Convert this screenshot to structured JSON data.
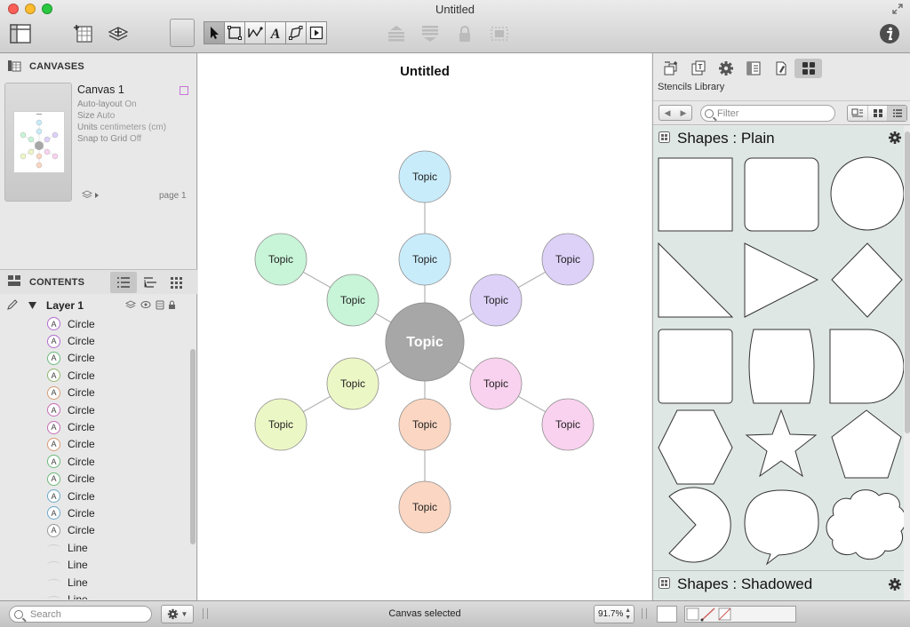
{
  "window": {
    "title": "Untitled"
  },
  "colors": {
    "accent_purple": "#b06ad0",
    "node_center": "#a7a7a7",
    "node_blue": "#c9ecfb",
    "node_green": "#c8f4d8",
    "node_purple": "#ddd1f8",
    "node_pink": "#f9d2ef",
    "node_yellow": "#ecf7c6",
    "node_peach": "#fbd6c2"
  },
  "toolbar": {
    "icons": [
      "sidebar-toggle-icon",
      "canvas-add-icon",
      "layer-add-icon",
      "style-well-icon",
      "selection-tool-icon",
      "shape-tool-icon",
      "line-tool-icon",
      "text-tool-icon",
      "pen-tool-icon",
      "browse-tool-icon",
      "bring-front-icon",
      "send-back-icon",
      "lock-icon",
      "group-icon",
      "inspector-info-icon"
    ]
  },
  "canvases": {
    "header": "CANVASES",
    "canvas_name": "Canvas 1",
    "props": [
      {
        "key": "Auto-layout",
        "value": "On"
      },
      {
        "key": "Size",
        "value": "Auto"
      },
      {
        "key": "Units",
        "value": "centimeters (cm)"
      },
      {
        "key": "Snap to Grid",
        "value": "Off"
      }
    ],
    "page_label": "page 1"
  },
  "contents": {
    "header": "CONTENTS",
    "layer_name": "Layer 1",
    "items": [
      {
        "name": "Circle",
        "badge": "A",
        "color": "#b06ad0"
      },
      {
        "name": "Circle",
        "badge": "A",
        "color": "#b06ad0"
      },
      {
        "name": "Circle",
        "badge": "A",
        "color": "#6ab97a"
      },
      {
        "name": "Circle",
        "badge": "A",
        "color": "#8fb86a"
      },
      {
        "name": "Circle",
        "badge": "A",
        "color": "#d89a72"
      },
      {
        "name": "Circle",
        "badge": "A",
        "color": "#c56db5"
      },
      {
        "name": "Circle",
        "badge": "A",
        "color": "#c56db5"
      },
      {
        "name": "Circle",
        "badge": "A",
        "color": "#d89a72"
      },
      {
        "name": "Circle",
        "badge": "A",
        "color": "#6ab97a"
      },
      {
        "name": "Circle",
        "badge": "A",
        "color": "#6ab97a"
      },
      {
        "name": "Circle",
        "badge": "A",
        "color": "#6aa8c9"
      },
      {
        "name": "Circle",
        "badge": "A",
        "color": "#6aa8c9"
      },
      {
        "name": "Circle",
        "badge": "A",
        "color": "#9a9a9a"
      },
      {
        "name": "Line",
        "badge": ""
      },
      {
        "name": "Line",
        "badge": ""
      },
      {
        "name": "Line",
        "badge": ""
      },
      {
        "name": "Line",
        "badge": ""
      }
    ]
  },
  "canvas": {
    "title": "Untitled",
    "center": {
      "label": "Topic"
    },
    "nodes": [
      {
        "label": "Topic"
      },
      {
        "label": "Topic"
      },
      {
        "label": "Topic"
      },
      {
        "label": "Topic"
      },
      {
        "label": "Topic"
      },
      {
        "label": "Topic"
      },
      {
        "label": "Topic"
      },
      {
        "label": "Topic"
      },
      {
        "label": "Topic"
      },
      {
        "label": "Topic"
      },
      {
        "label": "Topic"
      },
      {
        "label": "Topic"
      }
    ]
  },
  "stencils": {
    "library_label": "Stencils Library",
    "filter_placeholder": "Filter",
    "groups": [
      {
        "title": "Shapes : Plain"
      },
      {
        "title": "Shapes : Shadowed"
      }
    ],
    "shapes": [
      "square",
      "rounded-square",
      "circle",
      "right-triangle",
      "triangle",
      "diamond",
      "rect-rounded-small",
      "barrel",
      "d-shape",
      "hexagon",
      "star",
      "pentagon",
      "pacman",
      "speech-bubble",
      "cloud"
    ]
  },
  "status": {
    "search_placeholder": "Search",
    "message": "Canvas selected",
    "zoom": "91.7%"
  }
}
